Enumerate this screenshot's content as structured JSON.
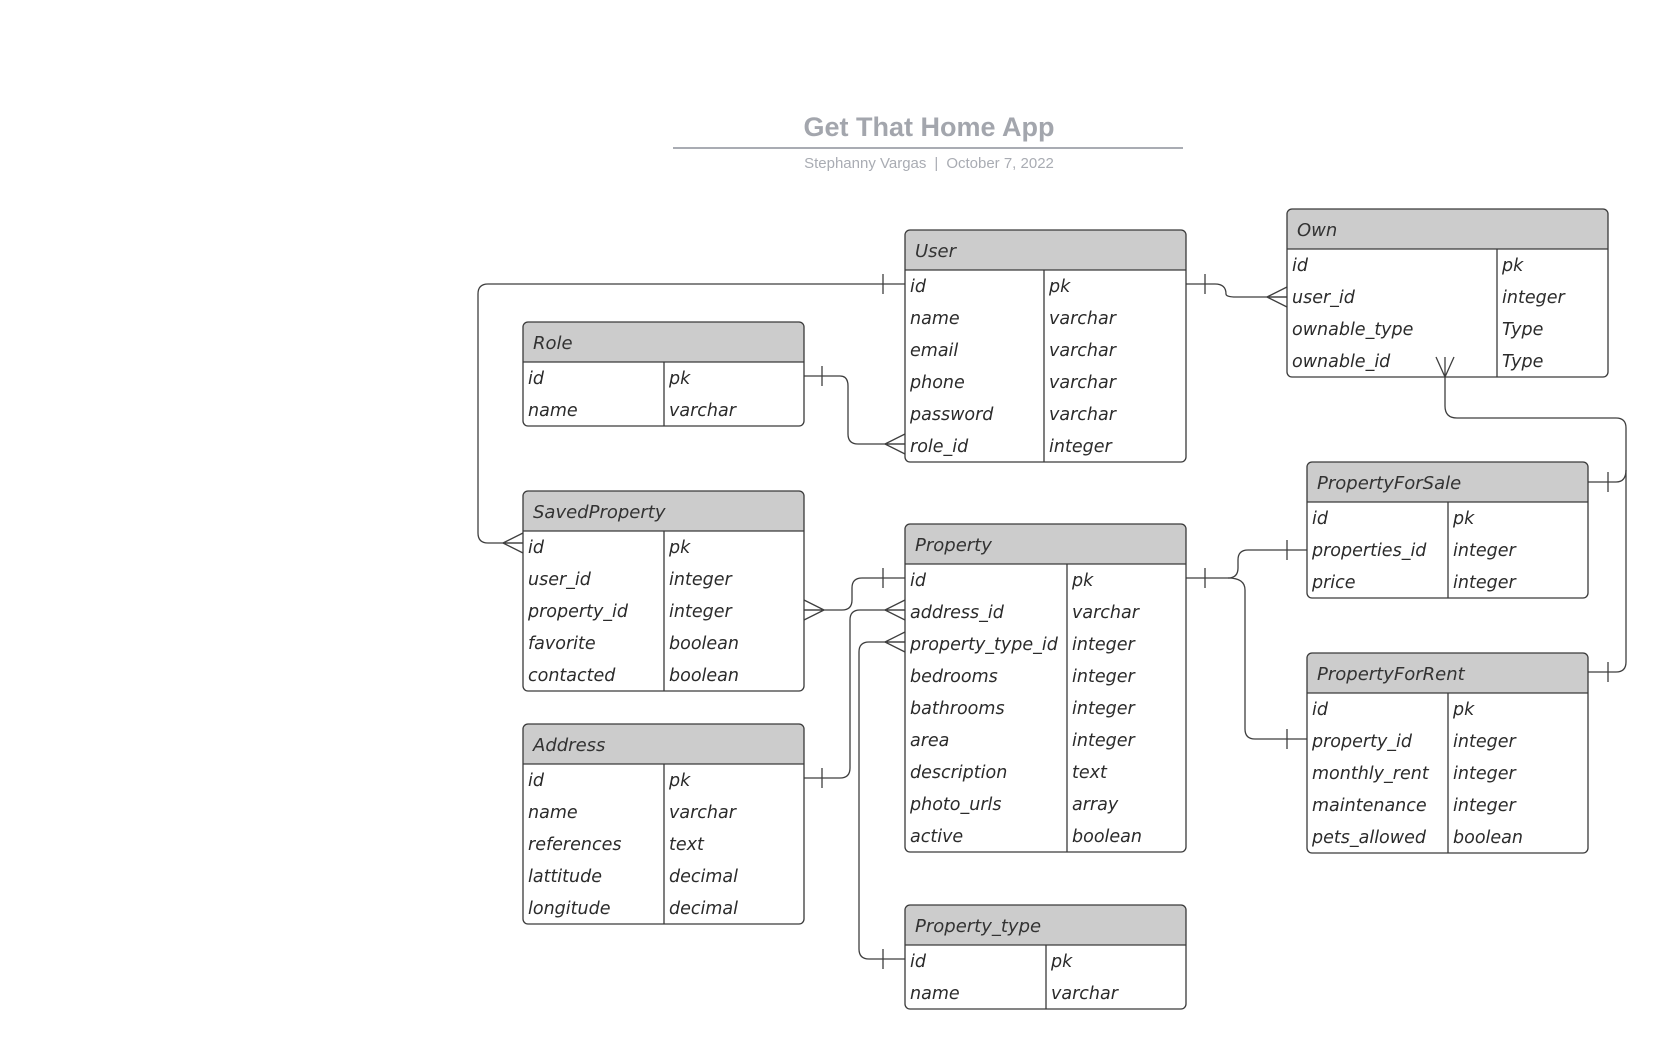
{
  "header": {
    "title": "Get That Home App",
    "author": "Stephanny Vargas",
    "separator": "|",
    "date": "October 7, 2022"
  },
  "colors": {
    "entity_header": "#cccccc",
    "entity_border": "#3a3a3a",
    "connector": "#3f3f3f",
    "title_text": "#a3a6ad"
  },
  "entities": [
    {
      "key": "user",
      "name": "User",
      "rows": [
        [
          "id",
          "pk"
        ],
        [
          "name",
          "varchar"
        ],
        [
          "email",
          "varchar"
        ],
        [
          "phone",
          "varchar"
        ],
        [
          "password",
          "varchar"
        ],
        [
          "role_id",
          "integer"
        ]
      ]
    },
    {
      "key": "own",
      "name": "Own",
      "rows": [
        [
          "id",
          "pk"
        ],
        [
          "user_id",
          "integer"
        ],
        [
          "ownable_type",
          "Type"
        ],
        [
          "ownable_id",
          "Type"
        ]
      ]
    },
    {
      "key": "role",
      "name": "Role",
      "rows": [
        [
          "id",
          "pk"
        ],
        [
          "name",
          "varchar"
        ]
      ]
    },
    {
      "key": "savedproperty",
      "name": "SavedProperty",
      "rows": [
        [
          "id",
          "pk"
        ],
        [
          "user_id",
          "integer"
        ],
        [
          "property_id",
          "integer"
        ],
        [
          "favorite",
          "boolean"
        ],
        [
          "contacted",
          "boolean"
        ]
      ]
    },
    {
      "key": "property",
      "name": "Property",
      "rows": [
        [
          "id",
          "pk"
        ],
        [
          "address_id",
          "varchar"
        ],
        [
          "property_type_id",
          "integer"
        ],
        [
          "bedrooms",
          "integer"
        ],
        [
          "bathrooms",
          "integer"
        ],
        [
          "area",
          "integer"
        ],
        [
          "description",
          "text"
        ],
        [
          "photo_urls",
          "array"
        ],
        [
          "active",
          "boolean"
        ]
      ]
    },
    {
      "key": "propertyforsale",
      "name": "PropertyForSale",
      "rows": [
        [
          "id",
          "pk"
        ],
        [
          "properties_id",
          "integer"
        ],
        [
          "price",
          "integer"
        ]
      ]
    },
    {
      "key": "propertyforrent",
      "name": "PropertyForRent",
      "rows": [
        [
          "id",
          "pk"
        ],
        [
          "property_id",
          "integer"
        ],
        [
          "monthly_rent",
          "integer"
        ],
        [
          "maintenance",
          "integer"
        ],
        [
          "pets_allowed",
          "boolean"
        ]
      ]
    },
    {
      "key": "address",
      "name": "Address",
      "rows": [
        [
          "id",
          "pk"
        ],
        [
          "name",
          "varchar"
        ],
        [
          "references",
          "text"
        ],
        [
          "lattitude",
          "decimal"
        ],
        [
          "longitude",
          "decimal"
        ]
      ]
    },
    {
      "key": "property_type",
      "name": "Property_type",
      "rows": [
        [
          "id",
          "pk"
        ],
        [
          "name",
          "varchar"
        ]
      ]
    }
  ],
  "relationships": [
    {
      "from": "user.id",
      "from_cardinality": "one",
      "to": "savedproperty.id",
      "to_cardinality": "many"
    },
    {
      "from": "user.id",
      "from_cardinality": "one",
      "to": "own.user_id",
      "to_cardinality": "many"
    },
    {
      "from": "role.id",
      "from_cardinality": "one",
      "to": "user.role_id",
      "to_cardinality": "many"
    },
    {
      "from": "property.id",
      "from_cardinality": "one",
      "to": "savedproperty.property_id",
      "to_cardinality": "many"
    },
    {
      "from": "address.id",
      "from_cardinality": "one",
      "to": "property.address_id",
      "to_cardinality": "many"
    },
    {
      "from": "property_type.id",
      "from_cardinality": "one",
      "to": "property.property_type_id",
      "to_cardinality": "many"
    },
    {
      "from": "property.id",
      "from_cardinality": "one",
      "to": "propertyforsale.properties_id",
      "to_cardinality": "one"
    },
    {
      "from": "property.id",
      "from_cardinality": "one",
      "to": "propertyforrent.property_id",
      "to_cardinality": "one"
    },
    {
      "from": "propertyforsale",
      "from_cardinality": "one",
      "to": "own.ownable_id",
      "to_cardinality": "many"
    },
    {
      "from": "propertyforrent",
      "from_cardinality": "one",
      "to": "own.ownable_id",
      "to_cardinality": "many"
    }
  ]
}
